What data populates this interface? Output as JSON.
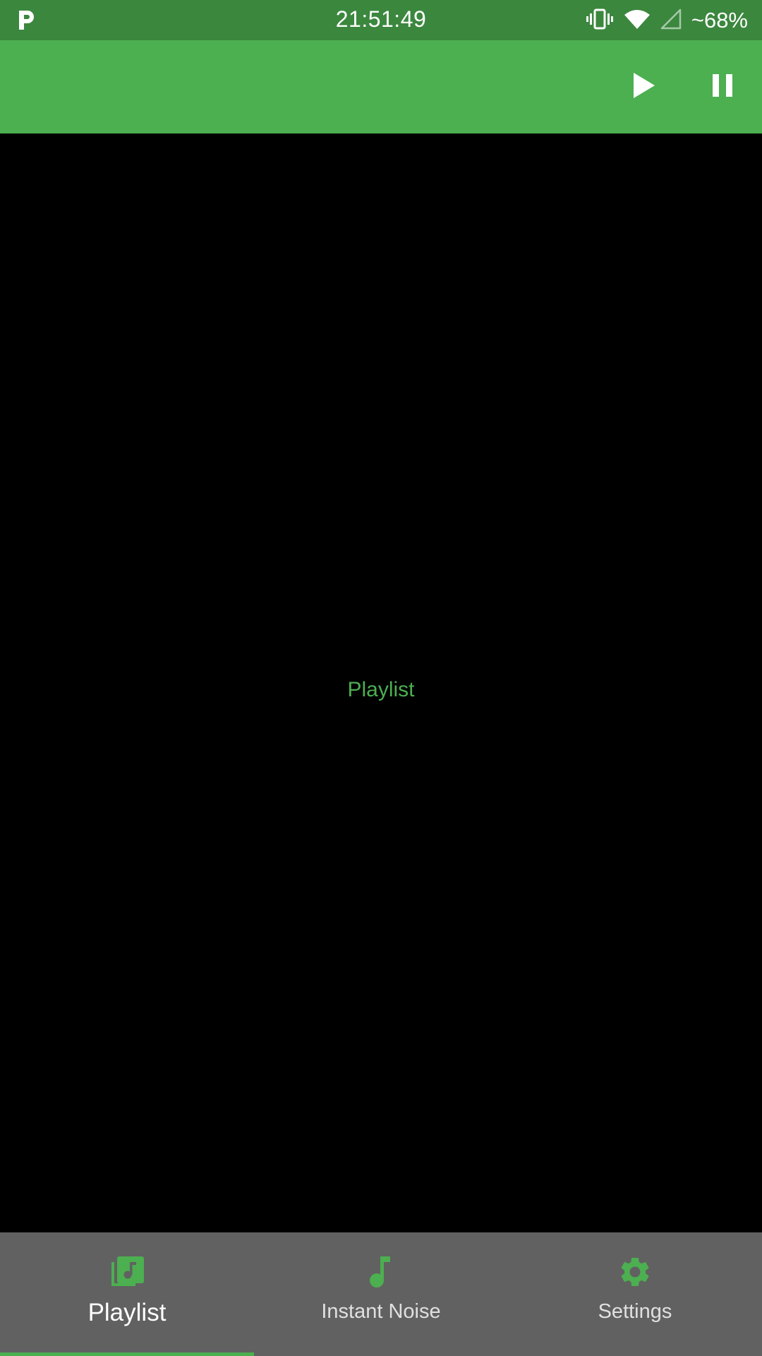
{
  "status_bar": {
    "time": "21:51:49",
    "battery": "~68%",
    "icons": [
      "parking-app-icon",
      "vibrate-icon",
      "wifi-icon",
      "signal-icon"
    ]
  },
  "toolbar": {
    "actions": [
      "play-icon",
      "pause-icon"
    ]
  },
  "content": {
    "label": "Playlist"
  },
  "bottom_nav": {
    "items": [
      {
        "label": "Playlist",
        "icon": "library-music-icon",
        "active": true
      },
      {
        "label": "Instant Noise",
        "icon": "music-note-icon",
        "active": false
      },
      {
        "label": "Settings",
        "icon": "gear-icon",
        "active": false
      }
    ]
  },
  "colors": {
    "status_bar": "#3b873e",
    "app_bar": "#4caf50",
    "accent": "#4caf50",
    "nav_background": "#616161",
    "content_background": "#000000"
  }
}
